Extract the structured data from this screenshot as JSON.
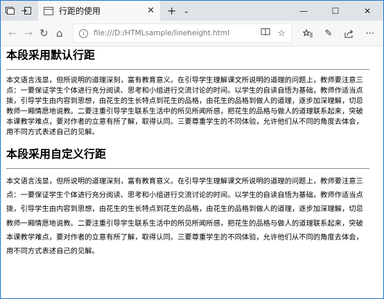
{
  "browser": {
    "tab_title": "行距的使用",
    "tab_close": "✕",
    "new_tab": "+",
    "tab_menu": "⌄",
    "window_controls": {
      "minimize": "—",
      "maximize": "☐",
      "close": "✕"
    },
    "nav": {
      "back": "←",
      "forward": "→",
      "refresh": "↻",
      "home": "⌂"
    },
    "address": {
      "info": "i",
      "url": "file:///D:/HTMLsample/lineheight.html"
    },
    "address_icons": {
      "reading_view": "📖",
      "favorite": "☆"
    },
    "toolbar_icons": {
      "favorites_hub": "☆",
      "notes": "✎",
      "share": "⇪",
      "more": "⋯"
    }
  },
  "page": {
    "section1": {
      "heading": "本段采用默认行距",
      "paragraph": "本文语言浅显，但所说明的道理深刻，富有教育意义。在引导学生理解课文所说明的道理的问题上，教师要注意三点：一要保证学生个体进行充分阅读、思考和小组进行交流讨论的时间。以学生的自读自悟为基础，教师作适当点拨，引导学生由内容到思想，由花生的生长特点到花生的品格，由花生的品格到做人的道理，逐步加深理解，切忌教师一厢情愿地说教。二要注重引导学生联系生活中的所见所闻所感，把花生的品格与做人的道理联系起来，突破本课教学难点，要对作者的立意有所了解，取得认同。三要尊重学生的不同体验，允许他们从不同的角度去体会，用不同方式表述自己的见解。"
    },
    "section2": {
      "heading": "本段采用自定义行距",
      "paragraph": "本文语言浅显，但所说明的道理深刻，富有教育意义。在引导学生理解课文所说明的道理的问题上，教师要注意三点：一要保证学生个体进行充分阅读、思考和小组进行交流讨论的时间。以学生的自读自悟为基础，教师作适当点拨，引导学生由内容到思想，由花生的生长特点到花生的品格，由花生的品格到做人的道理，逐步加深理解，切忌教师一厢情愿地说教。二要注重引导学生联系生活中的所见所闻所感，把花生的品格与做人的道理联系起来，突破本课教学难点，要对作者的立意有所了解，取得认同。三要尊重学生的不同体验，允许他们从不同的角度去体会，用不同方式表述自己的见解。"
    }
  },
  "colors": {
    "window_border": "#1a73c8",
    "titlebar": "#dfe3e8",
    "toolbar": "#f7f7f7"
  }
}
